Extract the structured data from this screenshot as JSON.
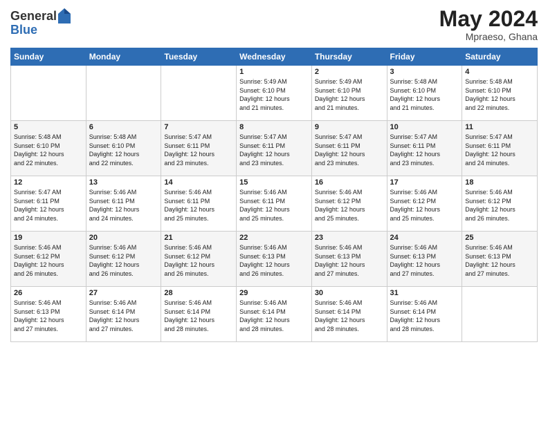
{
  "logo": {
    "general": "General",
    "blue": "Blue"
  },
  "title": {
    "month_year": "May 2024",
    "location": "Mpraeso, Ghana"
  },
  "headers": [
    "Sunday",
    "Monday",
    "Tuesday",
    "Wednesday",
    "Thursday",
    "Friday",
    "Saturday"
  ],
  "weeks": [
    [
      {
        "day": "",
        "info": ""
      },
      {
        "day": "",
        "info": ""
      },
      {
        "day": "",
        "info": ""
      },
      {
        "day": "1",
        "info": "Sunrise: 5:49 AM\nSunset: 6:10 PM\nDaylight: 12 hours\nand 21 minutes."
      },
      {
        "day": "2",
        "info": "Sunrise: 5:49 AM\nSunset: 6:10 PM\nDaylight: 12 hours\nand 21 minutes."
      },
      {
        "day": "3",
        "info": "Sunrise: 5:48 AM\nSunset: 6:10 PM\nDaylight: 12 hours\nand 21 minutes."
      },
      {
        "day": "4",
        "info": "Sunrise: 5:48 AM\nSunset: 6:10 PM\nDaylight: 12 hours\nand 22 minutes."
      }
    ],
    [
      {
        "day": "5",
        "info": "Sunrise: 5:48 AM\nSunset: 6:10 PM\nDaylight: 12 hours\nand 22 minutes."
      },
      {
        "day": "6",
        "info": "Sunrise: 5:48 AM\nSunset: 6:10 PM\nDaylight: 12 hours\nand 22 minutes."
      },
      {
        "day": "7",
        "info": "Sunrise: 5:47 AM\nSunset: 6:11 PM\nDaylight: 12 hours\nand 23 minutes."
      },
      {
        "day": "8",
        "info": "Sunrise: 5:47 AM\nSunset: 6:11 PM\nDaylight: 12 hours\nand 23 minutes."
      },
      {
        "day": "9",
        "info": "Sunrise: 5:47 AM\nSunset: 6:11 PM\nDaylight: 12 hours\nand 23 minutes."
      },
      {
        "day": "10",
        "info": "Sunrise: 5:47 AM\nSunset: 6:11 PM\nDaylight: 12 hours\nand 23 minutes."
      },
      {
        "day": "11",
        "info": "Sunrise: 5:47 AM\nSunset: 6:11 PM\nDaylight: 12 hours\nand 24 minutes."
      }
    ],
    [
      {
        "day": "12",
        "info": "Sunrise: 5:47 AM\nSunset: 6:11 PM\nDaylight: 12 hours\nand 24 minutes."
      },
      {
        "day": "13",
        "info": "Sunrise: 5:46 AM\nSunset: 6:11 PM\nDaylight: 12 hours\nand 24 minutes."
      },
      {
        "day": "14",
        "info": "Sunrise: 5:46 AM\nSunset: 6:11 PM\nDaylight: 12 hours\nand 25 minutes."
      },
      {
        "day": "15",
        "info": "Sunrise: 5:46 AM\nSunset: 6:11 PM\nDaylight: 12 hours\nand 25 minutes."
      },
      {
        "day": "16",
        "info": "Sunrise: 5:46 AM\nSunset: 6:12 PM\nDaylight: 12 hours\nand 25 minutes."
      },
      {
        "day": "17",
        "info": "Sunrise: 5:46 AM\nSunset: 6:12 PM\nDaylight: 12 hours\nand 25 minutes."
      },
      {
        "day": "18",
        "info": "Sunrise: 5:46 AM\nSunset: 6:12 PM\nDaylight: 12 hours\nand 26 minutes."
      }
    ],
    [
      {
        "day": "19",
        "info": "Sunrise: 5:46 AM\nSunset: 6:12 PM\nDaylight: 12 hours\nand 26 minutes."
      },
      {
        "day": "20",
        "info": "Sunrise: 5:46 AM\nSunset: 6:12 PM\nDaylight: 12 hours\nand 26 minutes."
      },
      {
        "day": "21",
        "info": "Sunrise: 5:46 AM\nSunset: 6:12 PM\nDaylight: 12 hours\nand 26 minutes."
      },
      {
        "day": "22",
        "info": "Sunrise: 5:46 AM\nSunset: 6:13 PM\nDaylight: 12 hours\nand 26 minutes."
      },
      {
        "day": "23",
        "info": "Sunrise: 5:46 AM\nSunset: 6:13 PM\nDaylight: 12 hours\nand 27 minutes."
      },
      {
        "day": "24",
        "info": "Sunrise: 5:46 AM\nSunset: 6:13 PM\nDaylight: 12 hours\nand 27 minutes."
      },
      {
        "day": "25",
        "info": "Sunrise: 5:46 AM\nSunset: 6:13 PM\nDaylight: 12 hours\nand 27 minutes."
      }
    ],
    [
      {
        "day": "26",
        "info": "Sunrise: 5:46 AM\nSunset: 6:13 PM\nDaylight: 12 hours\nand 27 minutes."
      },
      {
        "day": "27",
        "info": "Sunrise: 5:46 AM\nSunset: 6:14 PM\nDaylight: 12 hours\nand 27 minutes."
      },
      {
        "day": "28",
        "info": "Sunrise: 5:46 AM\nSunset: 6:14 PM\nDaylight: 12 hours\nand 28 minutes."
      },
      {
        "day": "29",
        "info": "Sunrise: 5:46 AM\nSunset: 6:14 PM\nDaylight: 12 hours\nand 28 minutes."
      },
      {
        "day": "30",
        "info": "Sunrise: 5:46 AM\nSunset: 6:14 PM\nDaylight: 12 hours\nand 28 minutes."
      },
      {
        "day": "31",
        "info": "Sunrise: 5:46 AM\nSunset: 6:14 PM\nDaylight: 12 hours\nand 28 minutes."
      },
      {
        "day": "",
        "info": ""
      }
    ]
  ]
}
